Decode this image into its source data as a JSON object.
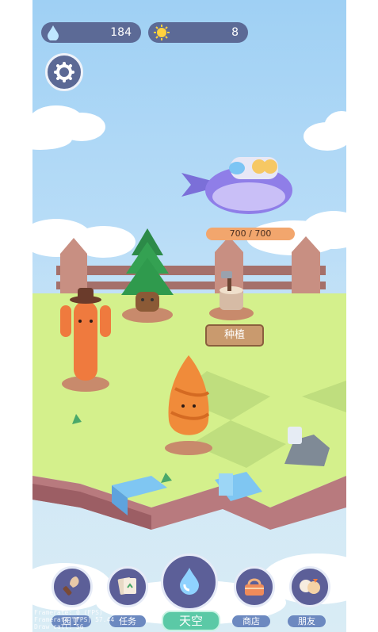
{
  "stats": {
    "water": {
      "value": "184",
      "icon": "water-drop-icon"
    },
    "sun": {
      "value": "8",
      "icon": "sun-icon"
    }
  },
  "settings": {
    "icon": "gear-icon"
  },
  "airship": {
    "progress_text": "700 / 700",
    "progress_fraction": 1.0
  },
  "plot": {
    "action_label": "种植"
  },
  "bottom_nav": [
    {
      "label": "园丁",
      "icon": "trowel-icon"
    },
    {
      "label": "任务",
      "icon": "task-cards-icon"
    },
    {
      "label": "天空",
      "icon": "water-drop-icon"
    },
    {
      "label": "商店",
      "icon": "basket-icon"
    },
    {
      "label": "朋友",
      "icon": "friends-icon"
    }
  ],
  "debug_overlay": {
    "line1": "Framerate: 0 (FPS)",
    "line2": "Framerate (FPS)  57.44",
    "line3": "Draw call: 56"
  },
  "colors": {
    "panel": "#5c6a96",
    "grass": "#d4f08c",
    "soil": "#b87a7e",
    "sky_button": "#5bc9a6",
    "nav_label": "#6c89c0"
  }
}
